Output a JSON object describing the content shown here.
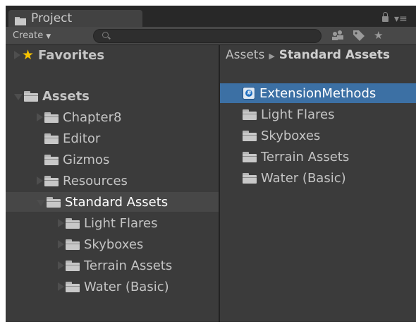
{
  "window": {
    "tab_label": "Project"
  },
  "toolbar": {
    "create_label": "Create",
    "search_value": "",
    "icons": [
      "scene-filter-icon",
      "label-tag-icon",
      "favorite-star-icon"
    ]
  },
  "tree": {
    "favorites_label": "Favorites",
    "assets_label": "Assets",
    "items": [
      {
        "label": "Chapter8",
        "has_children": true
      },
      {
        "label": "Editor",
        "has_children": false
      },
      {
        "label": "Gizmos",
        "has_children": false
      },
      {
        "label": "Resources",
        "has_children": true
      },
      {
        "label": "Standard Assets",
        "has_children": true,
        "expanded": true
      }
    ],
    "standard_children": [
      {
        "label": "Light Flares"
      },
      {
        "label": "Skyboxes"
      },
      {
        "label": "Terrain Assets"
      },
      {
        "label": "Water (Basic)"
      }
    ]
  },
  "browser": {
    "breadcrumb_root": "Assets",
    "breadcrumb_current": "Standard Assets",
    "items": [
      {
        "label": "ExtensionMethods",
        "type": "script",
        "selected": true
      },
      {
        "label": "Light Flares",
        "type": "folder"
      },
      {
        "label": "Skyboxes",
        "type": "folder"
      },
      {
        "label": "Terrain Assets",
        "type": "folder"
      },
      {
        "label": "Water (Basic)",
        "type": "folder"
      }
    ]
  },
  "colors": {
    "selection": "#3c70a4",
    "panel": "#3b3b3b",
    "favorite_star": "#f5c200"
  }
}
